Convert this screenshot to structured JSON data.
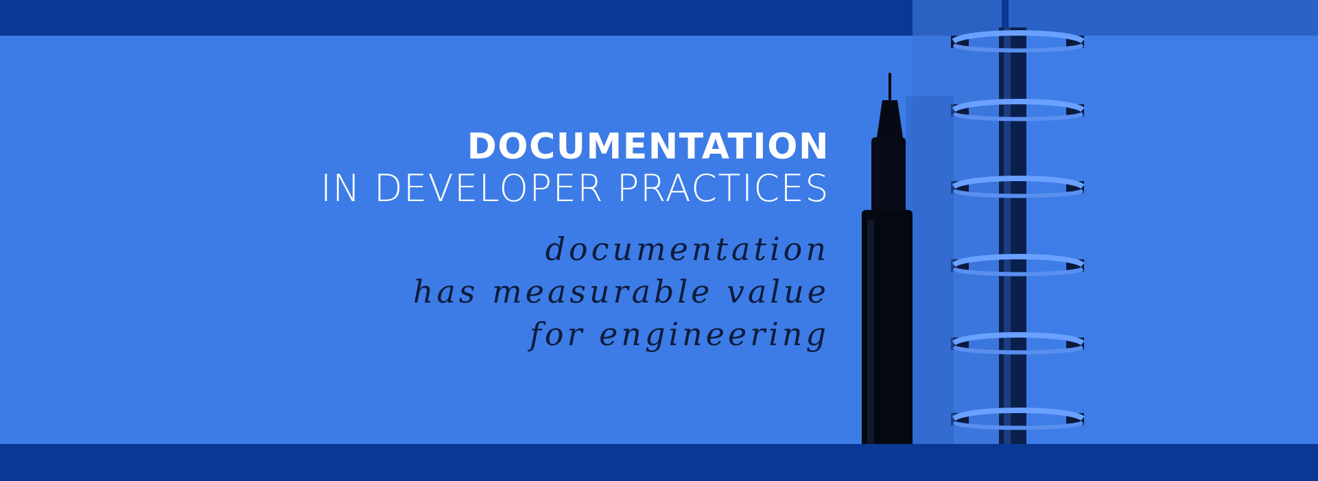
{
  "banner": {
    "title": "DOCUMENTATION",
    "subtitle": "IN DEVELOPER PRACTICES",
    "script_lines": [
      "documentation",
      "has measurable value",
      "for engineering"
    ]
  },
  "colors": {
    "background": "#3d7ce6",
    "band": "#0a3894",
    "text": "#ffffff",
    "script": "#0d1b3a"
  },
  "icons": [
    "pen-icon",
    "notebook-spiral-icon"
  ]
}
